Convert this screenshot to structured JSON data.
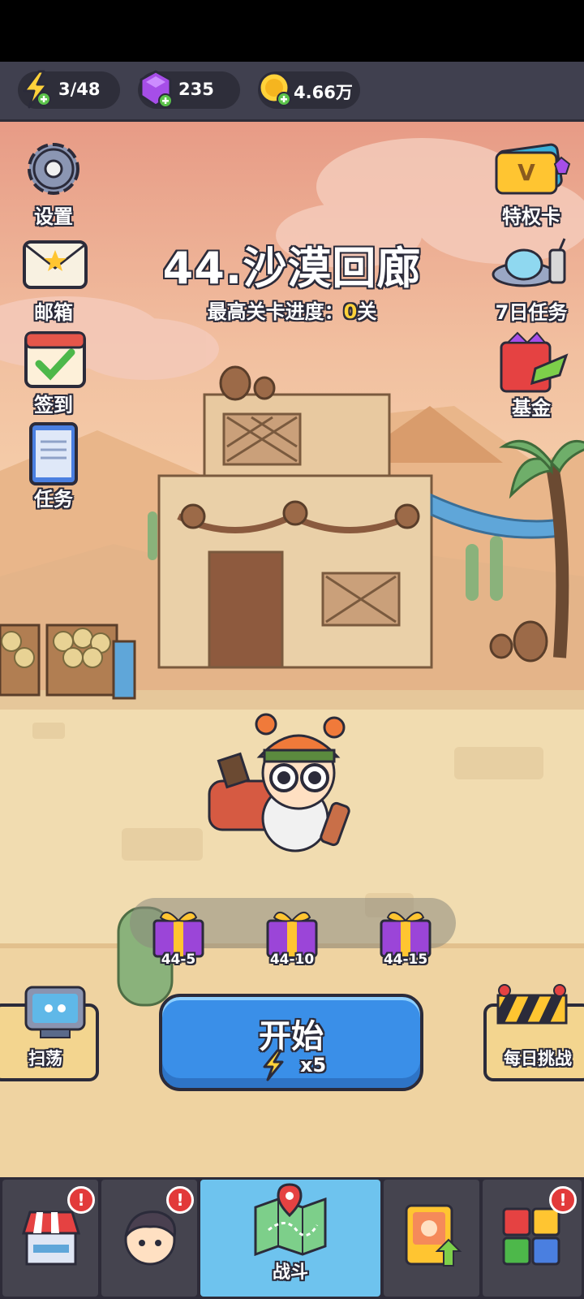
{
  "resources": {
    "energy": {
      "icon": "lightning-icon",
      "value": "3/48"
    },
    "gems": {
      "icon": "purple-gem-icon",
      "value": "235"
    },
    "coins": {
      "icon": "gold-coin-icon",
      "value": "4.66万"
    }
  },
  "left_menu": [
    {
      "icon": "gear-icon",
      "label": "设置"
    },
    {
      "icon": "mail-icon",
      "label": "邮箱"
    },
    {
      "icon": "calendar-check-icon",
      "label": "签到"
    },
    {
      "icon": "clipboard-icon",
      "label": "任务"
    }
  ],
  "right_menu": [
    {
      "icon": "vip-card-icon",
      "label": "特权卡"
    },
    {
      "icon": "ufo-icon",
      "label": "7日任务"
    },
    {
      "icon": "gift-bag-icon",
      "label": "基金"
    }
  ],
  "level": {
    "title": "44.沙漠回廊",
    "progress_prefix": "最高关卡进度：",
    "progress_value": "0",
    "progress_suffix": "关"
  },
  "rewards": [
    {
      "icon": "gift-box-icon",
      "label": "44-5"
    },
    {
      "icon": "gift-box-icon",
      "label": "44-10"
    },
    {
      "icon": "gift-box-icon",
      "label": "44-15"
    }
  ],
  "actions": {
    "sweep_label": "扫荡",
    "start_label": "开始",
    "start_cost": "x5",
    "daily_challenge_label": "每日挑战"
  },
  "bottom_nav": [
    {
      "icon": "shop-icon",
      "label": "",
      "badge": "!"
    },
    {
      "icon": "hero-icon",
      "label": "",
      "badge": "!"
    },
    {
      "icon": "map-icon",
      "label": "战斗",
      "badge": ""
    },
    {
      "icon": "card-upgrade-icon",
      "label": "",
      "badge": ""
    },
    {
      "icon": "puzzle-icon",
      "label": "",
      "badge": "!"
    }
  ],
  "colors": {
    "sky_top": "#e9a690",
    "sand": "#f1dcb0",
    "start_button": "#3a8fe8",
    "active_tab": "#6ec3ee",
    "badge": "#e23a3a",
    "highlight_number": "#ffd23a"
  }
}
